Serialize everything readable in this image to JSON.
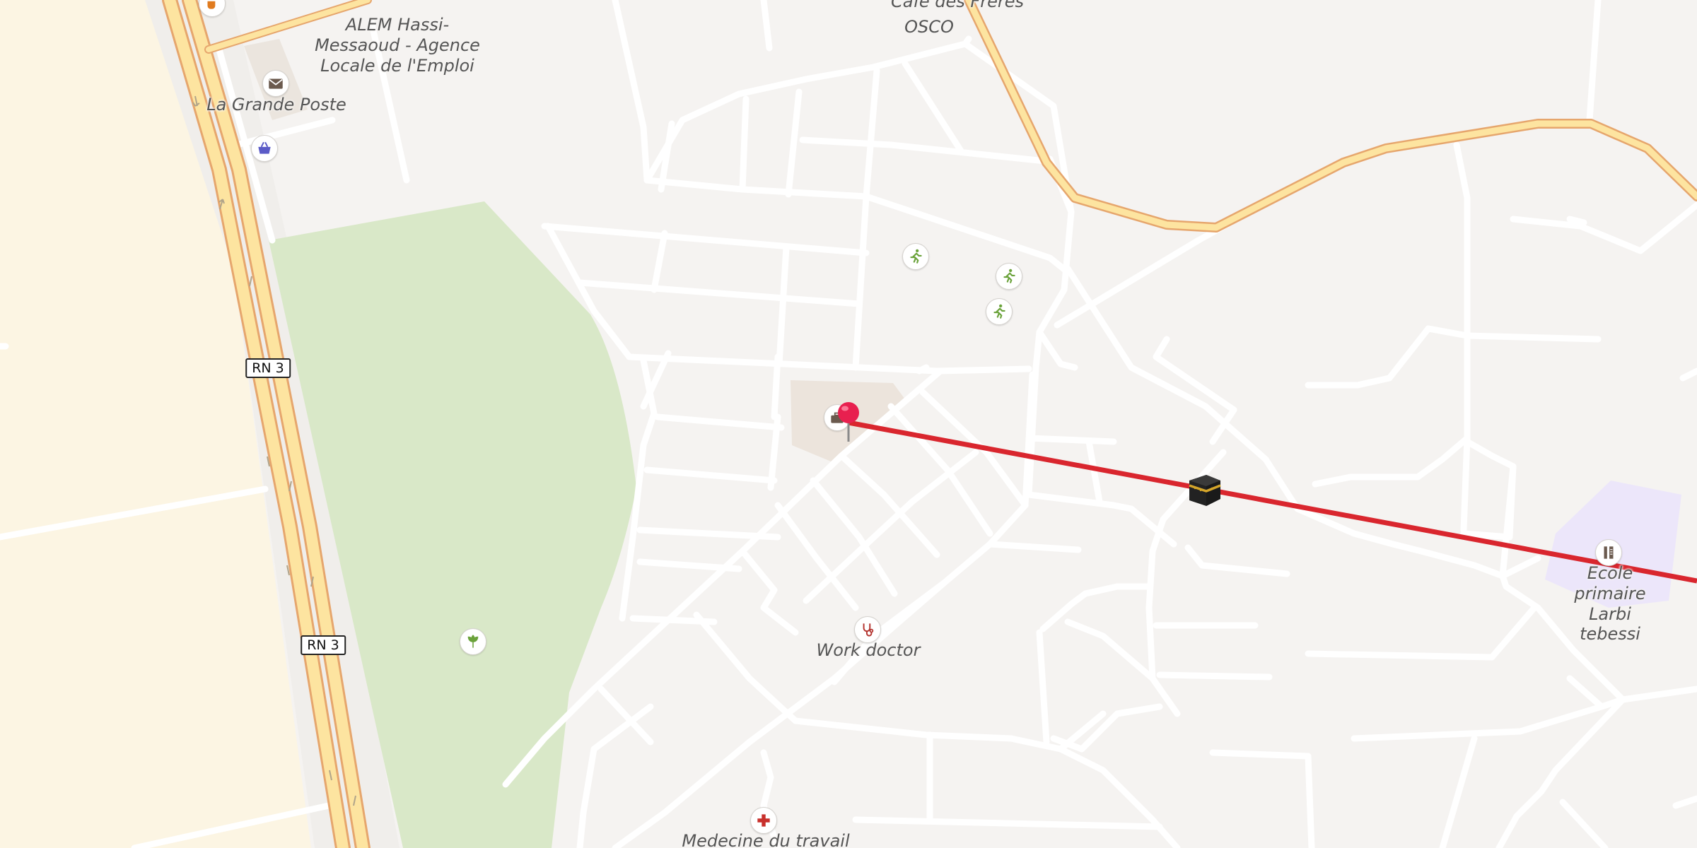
{
  "map": {
    "labels": {
      "alem_agency": "ALEM Hassi-\nMessaoud - Agence\nLocale de l'Emploi",
      "grande_poste": "La Grande Poste",
      "cafe_freres": "Cafe des Freres",
      "osco": "OSCO",
      "work_doctor": "Work doctor",
      "ecole_primaire": "Ecole primaire\nLarbi tebessi",
      "medecine_travail": "Medecine du travail"
    },
    "shields": {
      "rn3_upper": "RN 3",
      "rn3_lower": "RN 3"
    },
    "icons": {
      "post_office": "envelope-icon",
      "shop": "shopping-basket-icon",
      "fitness": "running-person-icon",
      "park": "garden-icon",
      "workplace": "briefcase-icon",
      "doctor": "stethoscope-icon",
      "hospital": "medical-cross-icon",
      "school": "school-icon",
      "cafe": "cafe-icon",
      "destination_marker": "kaaba-icon",
      "location_pin": "map-pin-icon"
    },
    "colors": {
      "background": "#f5f3f1",
      "desert_area": "#fcf5e3",
      "park_area": "#d9e8c8",
      "minor_road": "#ffffff",
      "major_road_fill": "#fde4a0",
      "major_road_casing": "#f0b86e",
      "qibla_line": "#d9262e",
      "pin": "#e8204f",
      "school_area": "#ece6fa"
    }
  }
}
